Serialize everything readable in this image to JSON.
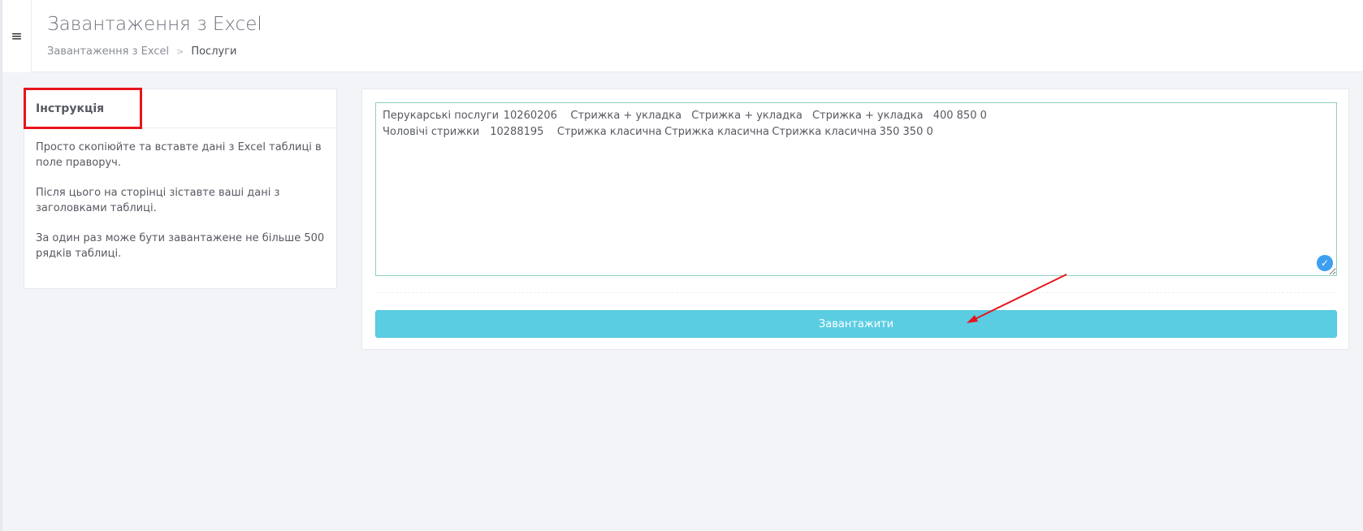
{
  "header": {
    "menu_icon": "≡",
    "title": "Завантаження з Excel",
    "breadcrumb": {
      "parent": "Завантаження з Excel",
      "separator": ">",
      "current": "Послуги"
    }
  },
  "instructions": {
    "title": "Інструкція",
    "paragraphs": [
      "Просто скопіюйте та вставте дані з Excel таблиці в поле праворуч.",
      "Після цього на сторінці зіставте ваші дані з заголовками таблиці.",
      "За один раз може бути завантажене не більше 500 рядків таблиці."
    ]
  },
  "upload": {
    "textarea_value": "Перукарські послуги\t10260206\tСтрижка + укладка\tСтрижка + укладка\tСтрижка + укладка\t400 850 0\nЧоловічі стрижки\t10288195\tСтрижка класична\tСтрижка класична\tСтрижка класична\t350 350 0",
    "button_label": "Завантажити",
    "valid_icon": "check-icon"
  },
  "colors": {
    "button": "#5bcde3",
    "highlight": "#e8141c",
    "valid_icon": "#3d9ff0",
    "textarea_border": "#8fd1c0"
  }
}
